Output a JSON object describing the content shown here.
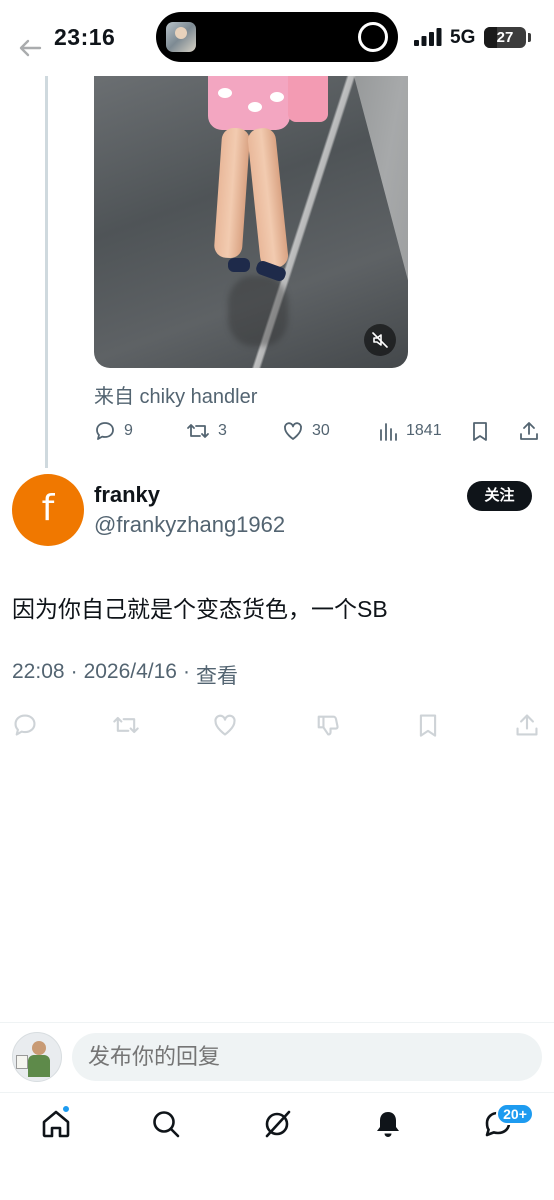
{
  "status_bar": {
    "time": "23:16",
    "network": "5G",
    "battery_level": "27"
  },
  "quoted_tweet": {
    "source_label": "来自 chiky handler",
    "stats": {
      "replies": "9",
      "retweets": "3",
      "likes": "30",
      "views": "1841"
    }
  },
  "reply_tweet": {
    "avatar_letter": "f",
    "avatar_color": "#f07800",
    "display_name": "franky",
    "handle": "@frankyzhang1962",
    "follow_label": "关注",
    "text": "因为你自己就是个变态货色，一个SB",
    "time": "22:08",
    "date": "2026/4/16",
    "view_link": "查看",
    "separator": "·"
  },
  "composer": {
    "placeholder": "发布你的回复"
  },
  "tab_bar": {
    "items": [
      "home-icon",
      "search-icon",
      "grok-icon",
      "notifications-icon",
      "messages-icon"
    ],
    "messages_badge": "20+"
  },
  "colors": {
    "accent": "#1d9bf0",
    "text_primary": "#0f1419",
    "text_secondary": "#536471"
  }
}
